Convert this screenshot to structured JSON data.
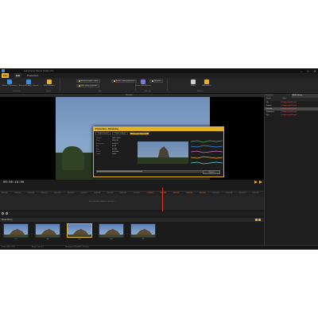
{
  "titlebar": {
    "title": "Ashampoo Movie Studio Pro",
    "min": "–",
    "max": "□",
    "close": "✕"
  },
  "menu": {
    "file": "File",
    "tabs": [
      "Edit",
      "Production"
    ]
  },
  "ribbon": {
    "buttons": [
      {
        "label": "Effects / Transitions",
        "color": "#3a8ee6"
      },
      {
        "label": "Add media file(s) / Import",
        "color": "#3a8ee6"
      },
      {
        "label": "Add transition",
        "color": "#e2b22a"
      },
      {
        "label": "Create and edit titles",
        "color": "#7b7bd6"
      },
      {
        "label": "Audio",
        "color": "#d0d0d0"
      },
      {
        "label": "Remove",
        "color": "#d0d0d0"
      }
    ],
    "small": [
      "Reverse audio / video",
      "Split video at marker",
      "Audio / video properties",
      "Remove",
      "Add marker"
    ],
    "groups": [
      "Clipboard",
      "Import",
      "Edit",
      "Edit clip",
      "Markers"
    ]
  },
  "preview": {
    "header": "Preview"
  },
  "dialog": {
    "title": "Production - Rendering",
    "tabs": [
      "Output format",
      "Video settings",
      "Rendering progress"
    ],
    "info": [
      {
        "k": "Frames",
        "v": "1826 / 4215"
      },
      {
        "k": "Time",
        "v": "00:01:16"
      },
      {
        "k": "Remaining",
        "v": "00:02:57"
      },
      {
        "k": "Fps",
        "v": "23.98"
      },
      {
        "k": "Size",
        "v": "43 MB"
      },
      {
        "k": "Bitrate",
        "v": "4500 kb/s"
      },
      {
        "k": "Codec",
        "v": "H.264"
      }
    ],
    "progress": 0.43,
    "cancel": "Cancel"
  },
  "transport": {
    "timecode": "00:00:19:08"
  },
  "timeline": {
    "ticks": [
      "00:00:00",
      "00:00:04",
      "00:00:08",
      "00:00:12",
      "00:00:16",
      "00:00:20",
      "00:00:24",
      "00:00:28",
      "00:00:32",
      "00:00:36",
      "00:00:40",
      "00:00:44",
      "00:00:48",
      "00:00:52",
      "00:00:56",
      "00:01:00",
      "00:01:04",
      "00:01:08",
      "00:01:12",
      "00:01:16"
    ],
    "hint": "Hier Mediendateien ablegen"
  },
  "bin": {
    "title": "Media library",
    "clips": [
      {
        "name": "001"
      },
      {
        "name": "002"
      },
      {
        "name": "003"
      },
      {
        "name": "004"
      },
      {
        "name": "005"
      }
    ]
  },
  "status": {
    "left": "Frame 1826 / 4215",
    "mid": "Aspect ratio 16:9",
    "right": "Resolution 1920x1080 / 23.98 fps"
  },
  "rpanel": {
    "tabs": [
      "Properties",
      "Media library"
    ],
    "cols": [
      "Name",
      "Value"
    ],
    "rows": [
      {
        "name": "File",
        "value": "C:\\Videos\\clip001.mp4"
      },
      {
        "name": "Format",
        "value": "C:\\Videos\\clip002.mp4"
      },
      {
        "name": "Duration",
        "value": "C:\\Videos\\clip003.mp4"
      },
      {
        "name": "Resolution",
        "value": "C:\\Videos\\clip004.mp4"
      },
      {
        "name": "Fps",
        "value": "C:\\Videos\\clip005.mp4"
      }
    ]
  },
  "colors": {
    "accent": "#e2b22a",
    "playhead": "#e53030",
    "progress": "#3fae3f"
  }
}
